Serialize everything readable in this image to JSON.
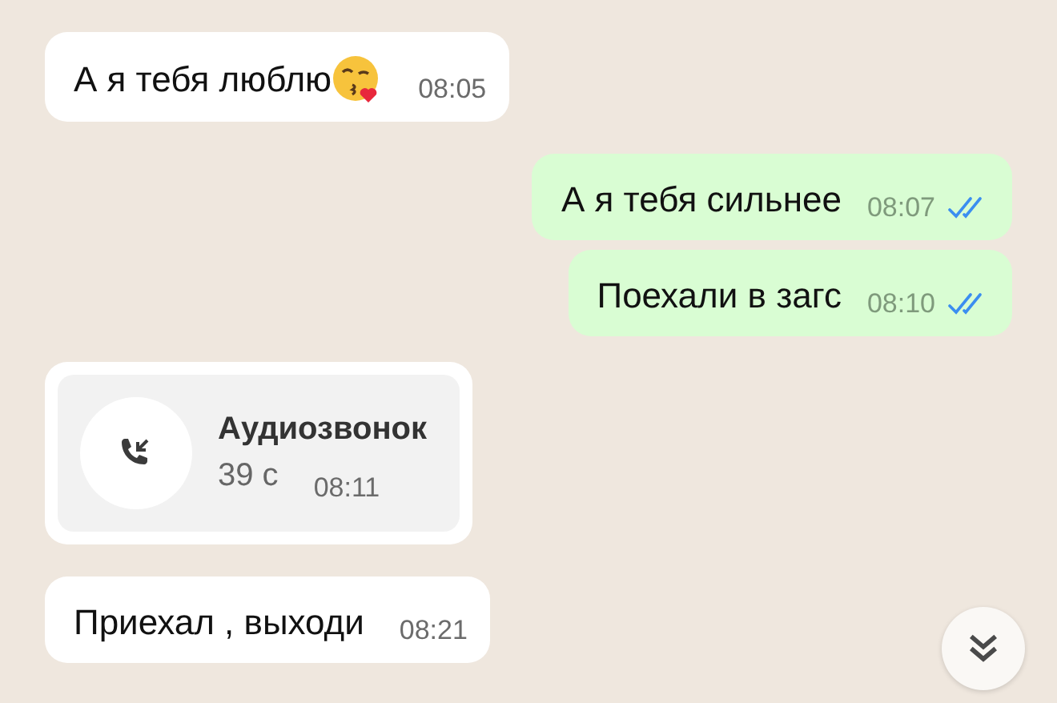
{
  "messages": [
    {
      "kind": "text",
      "outgoing": false,
      "text": "А я тебя люблю",
      "emoji": true,
      "time": "08:05"
    },
    {
      "kind": "text",
      "outgoing": true,
      "text": "А я тебя сильнее",
      "time": "08:07",
      "read": true
    },
    {
      "kind": "text",
      "outgoing": true,
      "text": "Поехали в загс",
      "time": "08:10",
      "read": true
    },
    {
      "kind": "call",
      "outgoing": false,
      "title": "Аудиозвонок",
      "duration": "39 с",
      "time": "08:11"
    },
    {
      "kind": "text",
      "outgoing": false,
      "text": "Приехал , выходи",
      "time": "08:21"
    }
  ]
}
